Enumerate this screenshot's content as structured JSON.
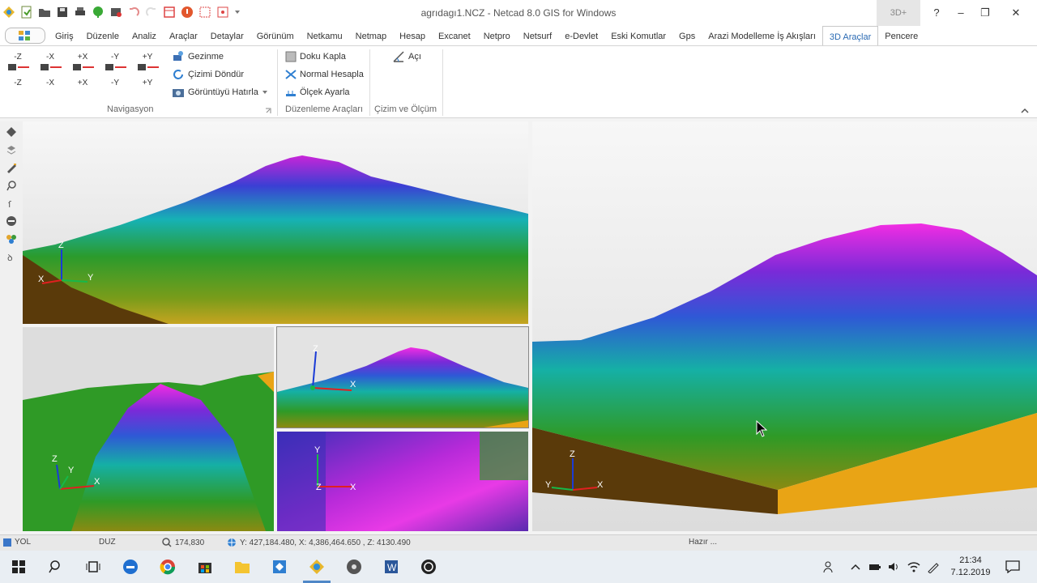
{
  "window": {
    "title": "agrıdagı1.NCZ - Netcad 8.0 GIS for Windows",
    "mode_badge": "3D+",
    "help": "?",
    "minimize": "–",
    "restore": "❐",
    "close": "✕"
  },
  "menu": {
    "tabs": [
      "Giriş",
      "Düzenle",
      "Analiz",
      "Araçlar",
      "Detaylar",
      "Görünüm",
      "Netkamu",
      "Netmap",
      "Hesap",
      "Excanet",
      "Netpro",
      "Netsurf",
      "e-Devlet",
      "Eski Komutlar",
      "Gps",
      "Arazi Modelleme İş Akışları",
      "3D Araçlar",
      "Pencere"
    ],
    "active_tab": "3D Araçlar",
    "mdi_minimize": "–",
    "mdi_restore": "❐",
    "mdi_close": "✕"
  },
  "ribbon": {
    "navigation": {
      "buttons": [
        {
          "top": "-Z",
          "bottom": "-Z"
        },
        {
          "top": "-X",
          "bottom": "-X"
        },
        {
          "top": "+X",
          "bottom": "+X"
        },
        {
          "top": "-Y",
          "bottom": "-Y"
        },
        {
          "top": "+Y",
          "bottom": "+Y"
        }
      ],
      "gezinme": "Gezinme",
      "cizimi_dondur": "Çizimi Döndür",
      "goruntuyu_hatirla": "Görüntüyü Hatırla",
      "group_label": "Navigasyon"
    },
    "editing": {
      "doku_kapla": "Doku Kapla",
      "normal_hesapla": "Normal Hesapla",
      "olcek_ayarla": "Ölçek Ayarla",
      "group_label": "Düzenleme Araçları"
    },
    "drawing": {
      "aci": "Açı",
      "group_label": "Çizim ve Ölçüm"
    }
  },
  "axes": {
    "x": "X",
    "y": "Y",
    "z": "Z"
  },
  "status": {
    "layer": "YOL",
    "mode": "DUZ",
    "zoom": "174,830",
    "coords": "Y: 427,184.480, X: 4,386,464.650 , Z: 4130.490",
    "state": "Hazır ..."
  },
  "taskbar": {
    "time": "21:34",
    "date": "7.12.2019"
  },
  "colors": {
    "accent": "#2a6ab3",
    "terrain_low": "#2d8a1f",
    "terrain_mid": "#18a9b8",
    "terrain_high": "#e41fd6",
    "ground_side": "#e9a415",
    "soil": "#5a3a0a"
  }
}
